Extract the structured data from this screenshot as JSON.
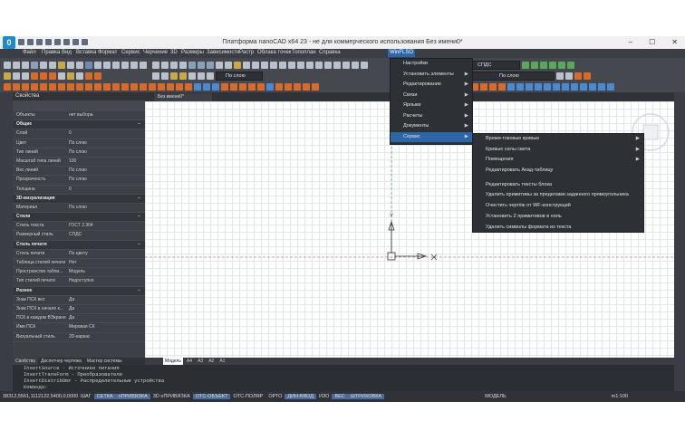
{
  "app": {
    "logo_letter": "0",
    "title": "Платформа nanoCAD x64 23 - не для коммерческого использования Без имени0*"
  },
  "menubar": {
    "items": [
      "Файл",
      "Правка",
      "Вид",
      "Вставка",
      "Формат",
      "Сервис",
      "Черчение",
      "3D",
      "Размеры",
      "Зависимости",
      "Растр",
      "Облака точек",
      "Топоплан",
      "Справка",
      "WinFLSO"
    ]
  },
  "ribbon": {
    "layer_dropdown": "По слою",
    "layer_dropdown2": "По слою",
    "style_dropdown": "СПДС"
  },
  "properties": {
    "panel_title": "Свойства",
    "objects_label": "Объекты",
    "objects_value": "нет выбора",
    "sections": [
      {
        "name": "Общие",
        "rows": [
          {
            "k": "Слой",
            "v": "0"
          },
          {
            "k": "Цвет",
            "v": "По слою"
          },
          {
            "k": "Тип линий",
            "v": "По слою"
          },
          {
            "k": "Масштаб типа линий",
            "v": "100"
          },
          {
            "k": "Вес линий",
            "v": "По слою"
          },
          {
            "k": "Прозрачность",
            "v": "По слою"
          },
          {
            "k": "Толщина",
            "v": "0"
          }
        ]
      },
      {
        "name": "3D-визуализация",
        "rows": [
          {
            "k": "Материал",
            "v": "По слою"
          }
        ]
      },
      {
        "name": "Стили",
        "rows": [
          {
            "k": "Стиль текста",
            "v": "ГОСТ 2.304"
          },
          {
            "k": "Размерный стиль",
            "v": "СПДС"
          }
        ]
      },
      {
        "name": "Стиль печати",
        "rows": [
          {
            "k": "Стиль печати",
            "v": "По цвету"
          },
          {
            "k": "Таблица стилей печати",
            "v": "Нет"
          },
          {
            "k": "Пространство табли...",
            "v": "Модель"
          },
          {
            "k": "Тип стилей печати",
            "v": "Недоступно"
          }
        ]
      },
      {
        "name": "Разное",
        "rows": [
          {
            "k": "Знак ПСК вкл",
            "v": "Да"
          },
          {
            "k": "Знак ПСК в начале к...",
            "v": "Да"
          },
          {
            "k": "ПСК в каждом ВЭкране",
            "v": "Да"
          },
          {
            "k": "Имя ПСК",
            "v": "Мировая СК"
          },
          {
            "k": "Визуальный стиль",
            "v": "2D-каркас"
          }
        ]
      }
    ],
    "bottom_tabs": [
      "Свойства",
      "Диспетчер чертежа",
      "Мастер системы"
    ]
  },
  "document": {
    "tab_label": "Без имени0*"
  },
  "layout_tabs": [
    "Модель",
    "A4",
    "A3",
    "A2",
    "A1"
  ],
  "ucs": {
    "y_label": "Y",
    "x_label": "X"
  },
  "command_lines": [
    "InsertSource - Источники питания",
    "InsertTransForm - Преобразователи",
    "InsertDistribOmr - Распределительные устройства",
    "Команда:"
  ],
  "status": {
    "coords": "38312,5561,1112122,5400,0,0000",
    "buttons": [
      "ШАГ",
      "СЕТКА",
      "оПРИВЯЗКА",
      "3D оПРИВЯЗКА",
      "ОТС-ОБЪЕКТ",
      "ОТС-ПОЛЯР",
      "ОРТО",
      "ДИН-ВВОД",
      "ИЗО",
      "ВЕС",
      "ШТРИХОВКА"
    ],
    "model": "МОДЕЛЬ",
    "scale": "m1:100"
  },
  "menu_winflso": {
    "items": [
      "Настройки",
      "Установить элементы",
      "Редактирование",
      "Связи",
      "Ярлыки",
      "Расчеты",
      "Документы",
      "Сервис"
    ],
    "has_sub": [
      false,
      true,
      true,
      true,
      true,
      true,
      true,
      true
    ],
    "active_index": 7
  },
  "submenu_service": {
    "items": [
      "Время-токовые кривые",
      "Кривые силы света",
      "Помещения",
      "Редактировать Акад-таблицу",
      "Редактировать тексты блока",
      "Удалить примитивы за пределами заданного прямоугольника",
      "Очистить чертёж от WF-конструкций",
      "Установить Z примитивов в ноль",
      "Удалить символы формата из текста"
    ],
    "has_sub": [
      true,
      true,
      true,
      false,
      false,
      false,
      false,
      false,
      false
    ]
  },
  "colors": {
    "menu_highlight": "#2a66a8",
    "ucs_x": "#c03030",
    "ucs_y": "#2a9a3a",
    "canvas_bg": "#ffffff"
  }
}
